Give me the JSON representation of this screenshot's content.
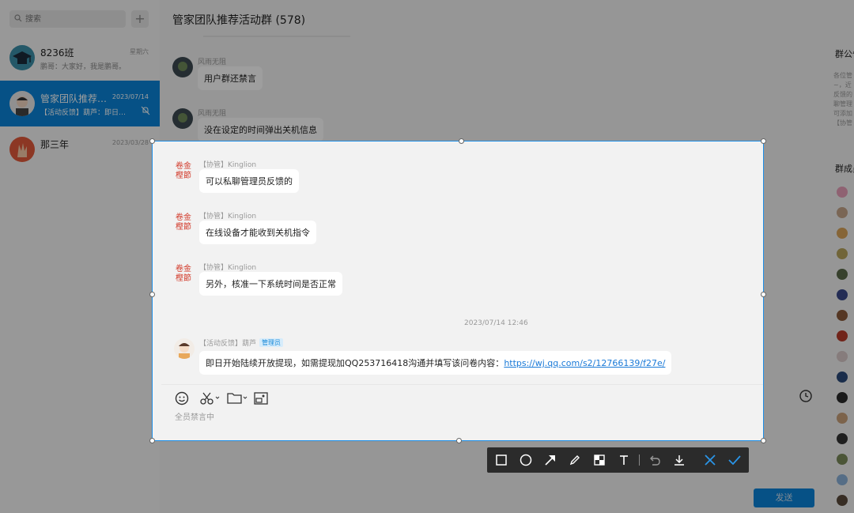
{
  "sidebar": {
    "search_placeholder": "搜索",
    "add_label": "+",
    "conversations": [
      {
        "name": "8236班",
        "time": "星期六",
        "preview": "鹏哥：大家好，我是鹏哥。"
      },
      {
        "name": "管家团队推荐…",
        "time": "2023/07/14",
        "preview": "【活动反馈】葫芦：即日…"
      },
      {
        "name": "那三年",
        "time": "2023/03/28",
        "preview": ""
      }
    ]
  },
  "chat": {
    "title": "管家团队推荐活动群 (578)",
    "messages_top": [
      {
        "sender": "风雨无阻",
        "text": "用户群还禁言"
      },
      {
        "sender": "风雨无阻",
        "text": "没在设定的时间弹出关机信息"
      }
    ],
    "messages": [
      {
        "sender": "【协管】Kinglion",
        "text": "可以私聊管理员反馈的"
      },
      {
        "sender": "【协管】Kinglion",
        "text": "在线设备才能收到关机指令"
      },
      {
        "sender": "【协管】Kinglion",
        "text": "另外，核准一下系统时间是否正常"
      }
    ],
    "timestamp": "2023/07/14 12:46",
    "last_message": {
      "sender": "【活动反馈】葫芦",
      "badge": "管理员",
      "text": "即日开始陆续开放提现，如需提现加QQ253716418沟通并填写该问卷内容：",
      "link": "https://wj.qq.com/s2/12766139/f27e/"
    },
    "input_placeholder": "全员禁言中",
    "send_label": "发送"
  },
  "right_panel": {
    "notice_title": "群公告",
    "notice_lines": [
      "各位管",
      "~，近",
      "反馈的",
      "聊管理",
      "可添加",
      "【协管"
    ],
    "members_title": "群成员"
  },
  "toolbar": {
    "tools": [
      "rectangle-icon",
      "ellipse-icon",
      "arrow-icon",
      "pen-icon",
      "mosaic-icon",
      "text-icon",
      "undo-icon",
      "download-icon",
      "cancel-icon",
      "confirm-icon"
    ]
  }
}
